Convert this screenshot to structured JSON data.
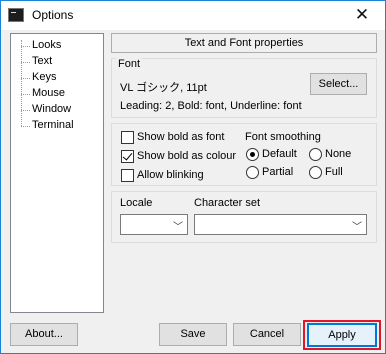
{
  "window": {
    "title": "Options",
    "close_glyph": "✕"
  },
  "tree": {
    "items": [
      "Looks",
      "Text",
      "Keys",
      "Mouse",
      "Window",
      "Terminal"
    ]
  },
  "header": {
    "title": "Text and Font properties"
  },
  "font": {
    "group_title": "Font",
    "name": "VL ゴシック, 11pt",
    "details": "Leading: 2, Bold: font, Underline: font",
    "select_label": "Select..."
  },
  "options": {
    "show_bold_as_font": {
      "label": "Show bold as font",
      "checked": false
    },
    "show_bold_as_colour": {
      "label": "Show bold as colour",
      "checked": true
    },
    "allow_blinking": {
      "label": "Allow blinking",
      "checked": false
    }
  },
  "smoothing": {
    "title": "Font smoothing",
    "default": "Default",
    "none": "None",
    "partial": "Partial",
    "full": "Full",
    "selected": "Default"
  },
  "locale": {
    "label": "Locale",
    "value": ""
  },
  "charset": {
    "label": "Character set",
    "value": ""
  },
  "buttons": {
    "about": "About...",
    "save": "Save",
    "cancel": "Cancel",
    "apply": "Apply"
  },
  "colors": {
    "accent": "#0078d7",
    "highlight": "#e0162b",
    "border": "#1883d7"
  }
}
